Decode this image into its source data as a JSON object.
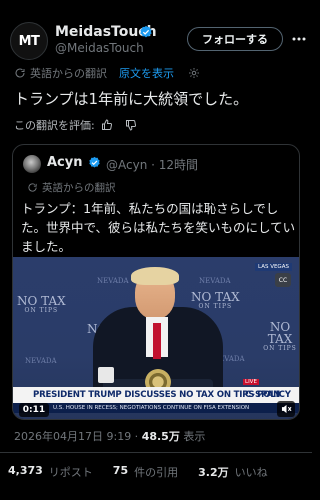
{
  "author": {
    "name": "MeidasTouch",
    "handle": "@MeidasTouch",
    "avatar_text": "MT",
    "verified_icon": "verified-badge-icon"
  },
  "header": {
    "follow_label": "フォローする",
    "more_icon": "more-options-icon"
  },
  "translation": {
    "label": "英語からの翻訳",
    "show_original": "原文を表示"
  },
  "post": {
    "text": "トランプは1年前に大統領でした。",
    "rate_label": "この翻訳を評価:"
  },
  "quote": {
    "name": "Acyn",
    "handle": "@Acyn",
    "time": "· 12時間",
    "translation_label": "英語からの翻訳",
    "text": "トランプ：1年前、私たちの国は恥さらしでした。世界中で、彼らは私たちを笑いものにしていました。",
    "video": {
      "backdrop_text": "NO TAX",
      "backdrop_sub": "ON TIPS",
      "backdrop_nevada": "NEVADA",
      "live_tag": "LAS VEGAS",
      "cc_label": "CC",
      "lower_third": "PRESIDENT TRUMP DISCUSSES NO TAX ON TIPS POLICY",
      "live_badge": "LIVE",
      "network": "C-SPAN",
      "ticker": "U.S. HOUSE IN RECESS; NEGOTIATIONS CONTINUE ON FISA EXTENSION",
      "ticker_tag": "TODAY",
      "timecode": "0:11"
    }
  },
  "meta": {
    "datetime": "2026年04月17日 9:19 · ",
    "views_count": "48.5万",
    "views_label": " 表示"
  },
  "stats": {
    "reposts_count": "4,373",
    "reposts_label": "リポスト",
    "quotes_count": "75",
    "quotes_label": "件の引用",
    "likes_count": "3.2万",
    "likes_label": "いいね"
  },
  "colors": {
    "accent": "#1d9bf0",
    "secondary_text": "#71767b",
    "background": "#000000"
  }
}
